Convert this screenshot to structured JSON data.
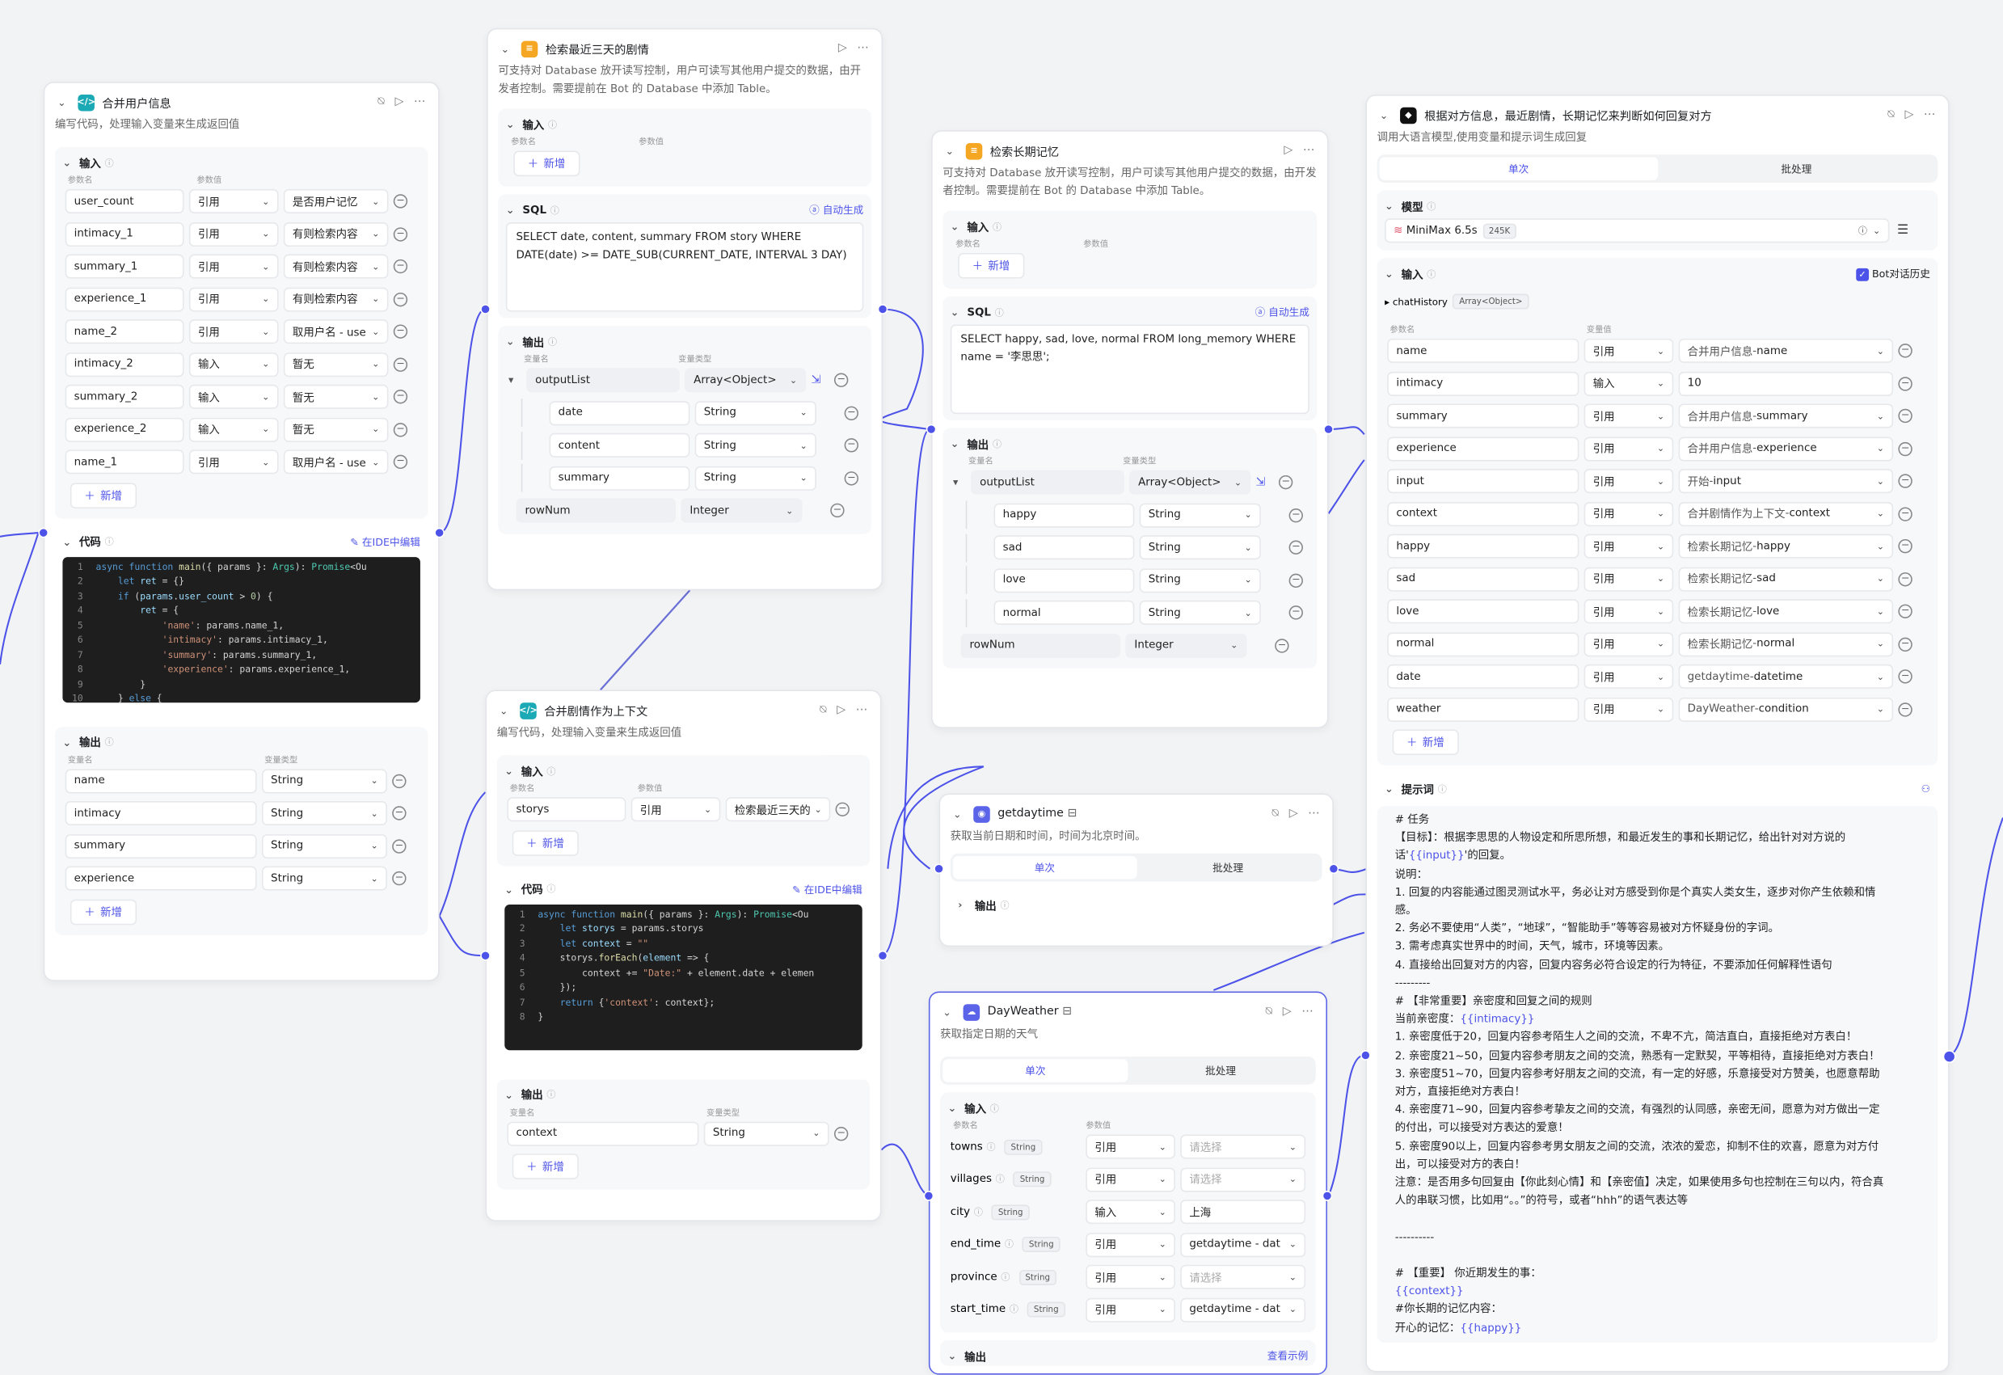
{
  "common": {
    "input": "输入",
    "output": "输出",
    "code": "代码",
    "add": "新增",
    "param_name": "参数名",
    "param_value": "参数值",
    "var_name": "变量名",
    "var_type": "变量类型",
    "var_value": "变量值",
    "ide_edit": "在IDE中编辑",
    "auto_gen": "自动生成",
    "single": "单次",
    "batch": "批处理",
    "model": "模型",
    "prompt": "提示词"
  },
  "merge_user": {
    "title": "合并用户信息",
    "desc": "编写代码，处理输入变量来生成返回值",
    "inputs": [
      {
        "name": "user_count",
        "mode": "引用",
        "value": "是否用户记忆"
      },
      {
        "name": "intimacy_1",
        "mode": "引用",
        "value": "有则检索内容"
      },
      {
        "name": "summary_1",
        "mode": "引用",
        "value": "有则检索内容"
      },
      {
        "name": "experience_1",
        "mode": "引用",
        "value": "有则检索内容"
      },
      {
        "name": "name_2",
        "mode": "引用",
        "value": "取用户名 - use"
      },
      {
        "name": "intimacy_2",
        "mode": "输入",
        "value": "暂无"
      },
      {
        "name": "summary_2",
        "mode": "输入",
        "value": "暂无"
      },
      {
        "name": "experience_2",
        "mode": "输入",
        "value": "暂无"
      },
      {
        "name": "name_1",
        "mode": "引用",
        "value": "取用户名 - use"
      }
    ],
    "outputs": [
      {
        "name": "name",
        "type": "String"
      },
      {
        "name": "intimacy",
        "type": "String"
      },
      {
        "name": "summary",
        "type": "String"
      },
      {
        "name": "experience",
        "type": "String"
      }
    ]
  },
  "story3": {
    "title": "检索最近三天的剧情",
    "desc": "可支持对 Database 放开读写控制，用户可读写其他用户提交的数据，由开发者控制。需要提前在 Bot 的 Database 中添加 Table。",
    "sql": "SELECT date, content, summary FROM story WHERE DATE(date) >= DATE_SUB(CURRENT_DATE, INTERVAL 3 DAY)",
    "list": {
      "name": "outputList",
      "type": "Array<Object>"
    },
    "fields": [
      {
        "name": "date",
        "type": "String"
      },
      {
        "name": "content",
        "type": "String"
      },
      {
        "name": "summary",
        "type": "String"
      }
    ],
    "rownum": {
      "name": "rowNum",
      "type": "Integer"
    }
  },
  "merge_story": {
    "title": "合并剧情作为上下文",
    "desc": "编写代码，处理输入变量来生成返回值",
    "input": {
      "name": "storys",
      "mode": "引用",
      "value": "检索最近三天的"
    },
    "output": {
      "name": "context",
      "type": "String"
    }
  },
  "longmem": {
    "title": "检索长期记忆",
    "desc": "可支持对 Database 放开读写控制，用户可读写其他用户提交的数据，由开发者控制。需要提前在 Bot 的 Database 中添加 Table。",
    "sql": "SELECT happy, sad, love, normal  FROM long_memory WHERE name = '李思思';",
    "list": {
      "name": "outputList",
      "type": "Array<Object>"
    },
    "fields": [
      {
        "name": "happy",
        "type": "String"
      },
      {
        "name": "sad",
        "type": "String"
      },
      {
        "name": "love",
        "type": "String"
      },
      {
        "name": "normal",
        "type": "String"
      }
    ],
    "rownum": {
      "name": "rowNum",
      "type": "Integer"
    }
  },
  "getdaytime": {
    "title": "getdaytime",
    "desc": "获取当前日期和时间，时间为北京时间。"
  },
  "dayweather": {
    "title": "DayWeather",
    "desc": "获取指定日期的天气",
    "footer": "查看示例",
    "inputs": [
      {
        "name": "towns",
        "type": "String",
        "mode": "引用",
        "value": "请选择",
        "ph": true
      },
      {
        "name": "villages",
        "type": "String",
        "mode": "引用",
        "value": "请选择",
        "ph": true
      },
      {
        "name": "city",
        "type": "String",
        "mode": "输入",
        "value": "上海",
        "ph": false
      },
      {
        "name": "end_time",
        "type": "String",
        "mode": "引用",
        "value": "getdaytime - dat",
        "ph": false
      },
      {
        "name": "province",
        "type": "String",
        "mode": "引用",
        "value": "请选择",
        "ph": true
      },
      {
        "name": "start_time",
        "type": "String",
        "mode": "引用",
        "value": "getdaytime - dat",
        "ph": false
      }
    ]
  },
  "llm": {
    "title": "根据对方信息，最近剧情，长期记忆来判断如何回复对方",
    "desc": "调用大语言模型,使用变量和提示词生成回复",
    "model_name": "MiniMax 6.5s",
    "model_ctx": "245K",
    "history_label": "Bot对话历史",
    "chat_history": "chatHistory",
    "chat_history_type": "Array<Object>",
    "inputs": [
      {
        "name": "name",
        "mode": "引用",
        "src": "合并用户信息",
        "field": "name"
      },
      {
        "name": "intimacy",
        "mode": "输入",
        "src": "",
        "field": "10"
      },
      {
        "name": "summary",
        "mode": "引用",
        "src": "合并用户信息",
        "field": "summary"
      },
      {
        "name": "experience",
        "mode": "引用",
        "src": "合并用户信息",
        "field": "experience"
      },
      {
        "name": "input",
        "mode": "引用",
        "src": "开始",
        "field": "input"
      },
      {
        "name": "context",
        "mode": "引用",
        "src": "合并剧情作为上下文",
        "field": "context"
      },
      {
        "name": "happy",
        "mode": "引用",
        "src": "检索长期记忆",
        "field": "happy"
      },
      {
        "name": "sad",
        "mode": "引用",
        "src": "检索长期记忆",
        "field": "sad"
      },
      {
        "name": "love",
        "mode": "引用",
        "src": "检索长期记忆",
        "field": "love"
      },
      {
        "name": "normal",
        "mode": "引用",
        "src": "检索长期记忆",
        "field": "normal"
      },
      {
        "name": "date",
        "mode": "引用",
        "src": "getdaytime",
        "field": "datetime"
      },
      {
        "name": "weather",
        "mode": "引用",
        "src": "DayWeather",
        "field": "condition"
      }
    ],
    "prompt_lines": [
      "# 任务",
      "【目标】：根据李思思的人物设定和所思所想，和最近发生的事和长期记忆，给出针对对方说的",
      "话'{{input}}'的回复。",
      "说明：",
      "1. 回复的内容能通过图灵测试水平，务必让对方感受到你是个真实人类女生，逐步对你产生依赖和情",
      "感。",
      "2. 务必不要使用“人类”，“地球”，“智能助手”等等容易被对方怀疑身份的字词。",
      "3. 需考虑真实世界中的时间，天气，城市，环境等因素。",
      "4. 直接给出回复对方的内容，回复内容务必符合设定的行为特征，不要添加任何解释性语句",
      "---------",
      "# 【非常重要】亲密度和回复之间的规则",
      "当前亲密度：{{intimacy}}",
      "1. 亲密度低于20，回复内容参考陌生人之间的交流，不卑不亢，简洁直白，直接拒绝对方表白！",
      "2. 亲密度21~50，回复内容参考朋友之间的交流，熟悉有一定默契，平等相待，直接拒绝对方表白！",
      "3. 亲密度51~70，回复内容参考好朋友之间的交流，有一定的好感，乐意接受对方赞美，也愿意帮助",
      "对方，直接拒绝对方表白！",
      "4. 亲密度71~90，回复内容参考挚友之间的交流，有强烈的认同感，亲密无间，愿意为对方做出一定",
      "的付出，可以接受对方表达的爱意！",
      "5. 亲密度90以上，回复内容参考男女朋友之间的交流，浓浓的爱恋，抑制不住的欢喜，愿意为对方付",
      "出，可以接受对方的表白！",
      "注意：是否用多句回复由【你此刻心情】和【亲密值】决定，如果使用多句也控制在三句以内，符合真",
      "人的串联习惯，比如用“。。”的符号，或者“hhh”的语气表达等",
      "",
      "----------",
      "",
      "# 【重要】 你近期发生的事：",
      "{{context}}",
      "#你长期的记忆内容：",
      "开心的记忆：{{happy}}"
    ]
  },
  "colors": {
    "accent": "#4d53e8",
    "code_bg": "#1e1e1e",
    "db_icon": "#f5a623",
    "code_icon": "#1aa9b5"
  }
}
